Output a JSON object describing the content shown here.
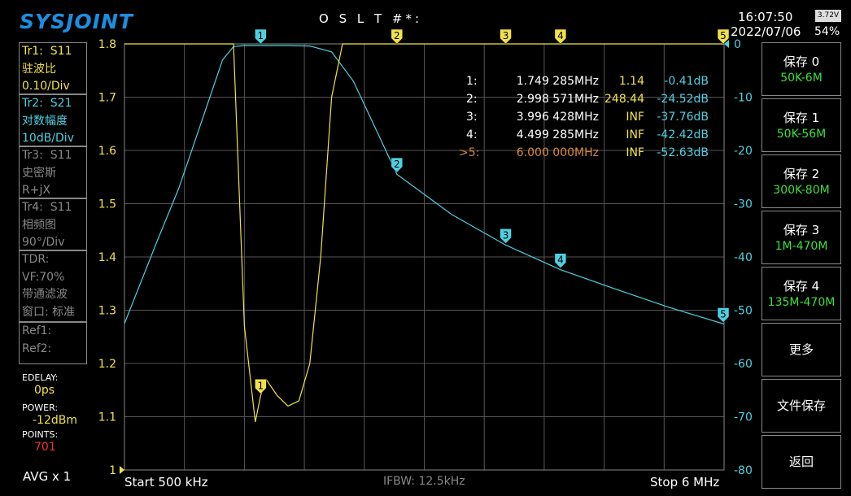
{
  "header": {
    "logo": "SYSJOINT",
    "cal_status": "O S L T #*:",
    "time": "16:07:50",
    "date": "2022/07/06",
    "battery_voltage": "3.72V",
    "battery_percent": "54%"
  },
  "traces": [
    {
      "id": "Tr1:",
      "param": "S11",
      "format": "驻波比",
      "scale": "0.10/Div",
      "color": "#f1e24a"
    },
    {
      "id": "Tr2:",
      "param": "S21",
      "format": "对数幅度",
      "scale": "10dB/Div",
      "color": "#4fd0e0"
    },
    {
      "id": "Tr3:",
      "param": "S11",
      "format": "史密斯",
      "scale": "R+jX",
      "color": "#888888"
    },
    {
      "id": "Tr4:",
      "param": "S11",
      "format": "相频图",
      "scale": "90°/Div",
      "color": "#888888"
    }
  ],
  "tdr": {
    "label": "TDR:",
    "vf": "VF:70%",
    "filter": "带通滤波",
    "window": "窗口: 标准"
  },
  "refs": {
    "ref1": "Ref1:",
    "ref2": "Ref2:"
  },
  "params": {
    "edelay_label": "EDELAY:",
    "edelay": "0ps",
    "power_label": "POWER:",
    "power": "-12dBm",
    "points_label": "POINTS:",
    "points": "701",
    "avg": "AVG x 1"
  },
  "buttons": [
    {
      "title": "保存 0",
      "sub": "50K-6M"
    },
    {
      "title": "保存 1",
      "sub": "50K-56M"
    },
    {
      "title": "保存 2",
      "sub": "300K-80M"
    },
    {
      "title": "保存 3",
      "sub": "1M-470M"
    },
    {
      "title": "保存 4",
      "sub": "135M-470M"
    },
    {
      "title": "更多",
      "sub": ""
    },
    {
      "title": "文件保存",
      "sub": ""
    },
    {
      "title": "返回",
      "sub": ""
    }
  ],
  "footer": {
    "start": "Start   500 kHz",
    "ifbw": "IFBW: 12.5kHz",
    "stop": "Stop   6 MHz"
  },
  "markers": [
    {
      "label": "1:",
      "freq": "1.749 285MHz",
      "swr": "1.14",
      "db": "-0.41dB",
      "active": false
    },
    {
      "label": "2:",
      "freq": "2.998 571MHz",
      "swr": "248.44",
      "db": "-24.52dB",
      "active": false
    },
    {
      "label": "3:",
      "freq": "3.996 428MHz",
      "swr": "INF",
      "db": "-37.76dB",
      "active": false
    },
    {
      "label": "4:",
      "freq": "4.499 285MHz",
      "swr": "INF",
      "db": "-42.42dB",
      "active": false
    },
    {
      "label": ">5:",
      "freq": "6.000 000MHz",
      "swr": "INF",
      "db": "-52.63dB",
      "active": true
    }
  ],
  "colors": {
    "swr": "#f1e24a",
    "s21": "#4fd0e0",
    "active_marker": "#d98a3a",
    "grid": "#555555"
  },
  "chart_data": {
    "type": "line",
    "x_range_mhz": [
      0.5,
      6.0
    ],
    "left_axis": {
      "ticks": [
        "1.8",
        "1.7",
        "1.6",
        "1.5",
        "1.4",
        "1.3",
        "1.2",
        "1.1",
        "1"
      ],
      "range": [
        1.0,
        1.8
      ]
    },
    "right_axis": {
      "ticks": [
        "0",
        "-10",
        "-20",
        "-30",
        "-40",
        "-50",
        "-60",
        "-70",
        "-80"
      ],
      "range": [
        -80,
        0
      ]
    },
    "series": [
      {
        "trace": "Tr1 S11 VSWR",
        "x": [
          0.5,
          1.5,
          1.6,
          1.7,
          1.749,
          1.8,
          1.9,
          2.0,
          2.1,
          2.2,
          2.3,
          2.4,
          2.5,
          2.6,
          6.0
        ],
        "y": [
          1.8,
          1.8,
          1.27,
          1.09,
          1.14,
          1.17,
          1.14,
          1.12,
          1.13,
          1.2,
          1.4,
          1.7,
          1.8,
          1.8,
          1.8
        ]
      },
      {
        "trace": "Tr2 S21 LogMag",
        "x": [
          0.5,
          0.8,
          1.0,
          1.2,
          1.4,
          1.5,
          1.6,
          2.0,
          2.2,
          2.4,
          2.6,
          3.0,
          3.5,
          4.0,
          4.5,
          5.0,
          5.5,
          6.0
        ],
        "y": [
          -52.5,
          -37,
          -27,
          -15,
          -3,
          -0.5,
          -0.3,
          -0.3,
          -0.4,
          -1.5,
          -7,
          -24.5,
          -32,
          -37.8,
          -42.4,
          -46,
          -49.5,
          -52.6
        ]
      }
    ],
    "marker_flags": [
      {
        "n": "1",
        "x": 1.749,
        "trace": "Tr1 S11 VSWR"
      },
      {
        "n": "1",
        "x": 1.749,
        "trace": "Tr2 S21 LogMag"
      },
      {
        "n": "2",
        "x": 2.998571,
        "trace": "Tr2 S21 LogMag"
      },
      {
        "n": "3",
        "x": 3.996428,
        "trace": "Tr2 S21 LogMag"
      },
      {
        "n": "4",
        "x": 4.499285,
        "trace": "Tr2 S21 LogMag"
      },
      {
        "n": "5",
        "x": 6.0,
        "trace": "Tr2 S21 LogMag"
      },
      {
        "n": "2",
        "x": 2.998571,
        "trace": "Tr1 S11 VSWR"
      },
      {
        "n": "3",
        "x": 3.996428,
        "trace": "Tr1 S11 VSWR"
      },
      {
        "n": "4",
        "x": 4.499285,
        "trace": "Tr1 S11 VSWR"
      },
      {
        "n": "5",
        "x": 6.0,
        "trace": "Tr1 S11 VSWR"
      }
    ]
  }
}
